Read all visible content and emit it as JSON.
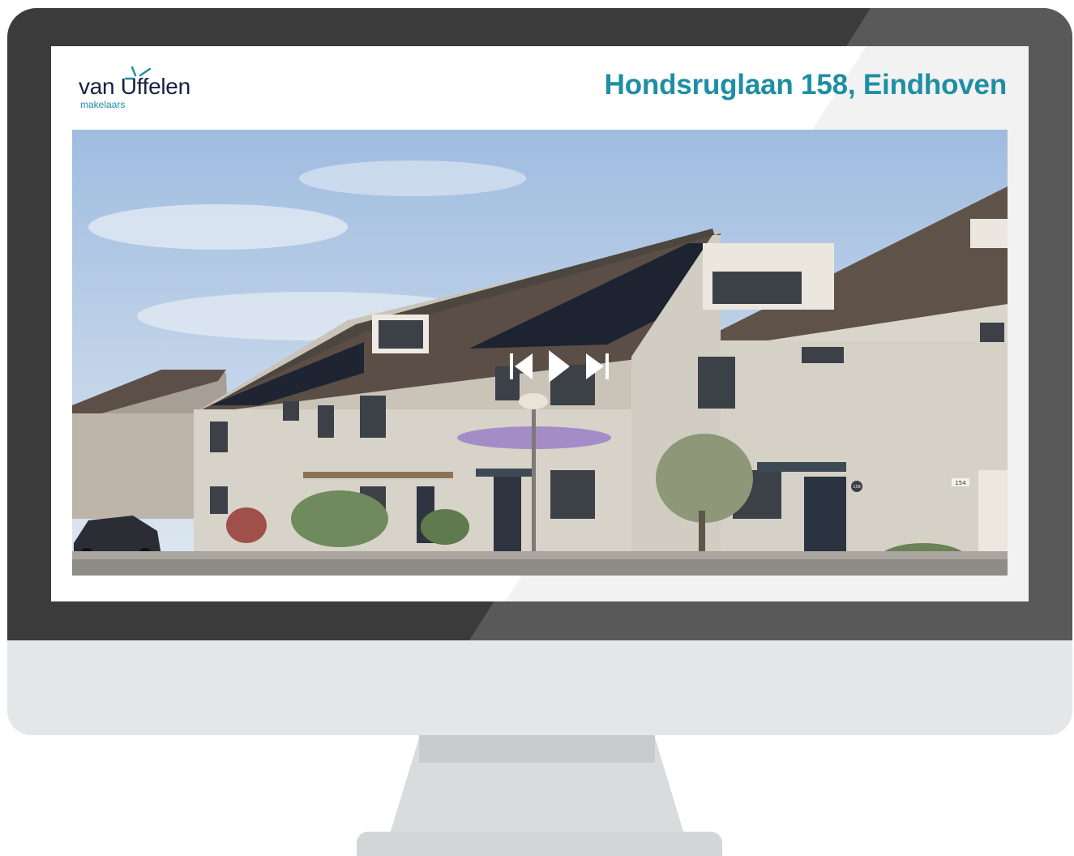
{
  "brand": {
    "name": "van Uffelen",
    "subtitle": "makelaars"
  },
  "listing": {
    "title": "Hondsruglaan 158, Eindhoven"
  },
  "photo": {
    "description_icon": "house-photo",
    "house_numbers": [
      "158",
      "154"
    ]
  },
  "slideshow_controls": {
    "previous_icon": "skip-back-icon",
    "play_icon": "play-icon",
    "next_icon": "skip-forward-icon"
  },
  "colors": {
    "accent": "#1e8ea3",
    "logo_dark": "#16213d",
    "bezel": "#3b3b3b"
  }
}
